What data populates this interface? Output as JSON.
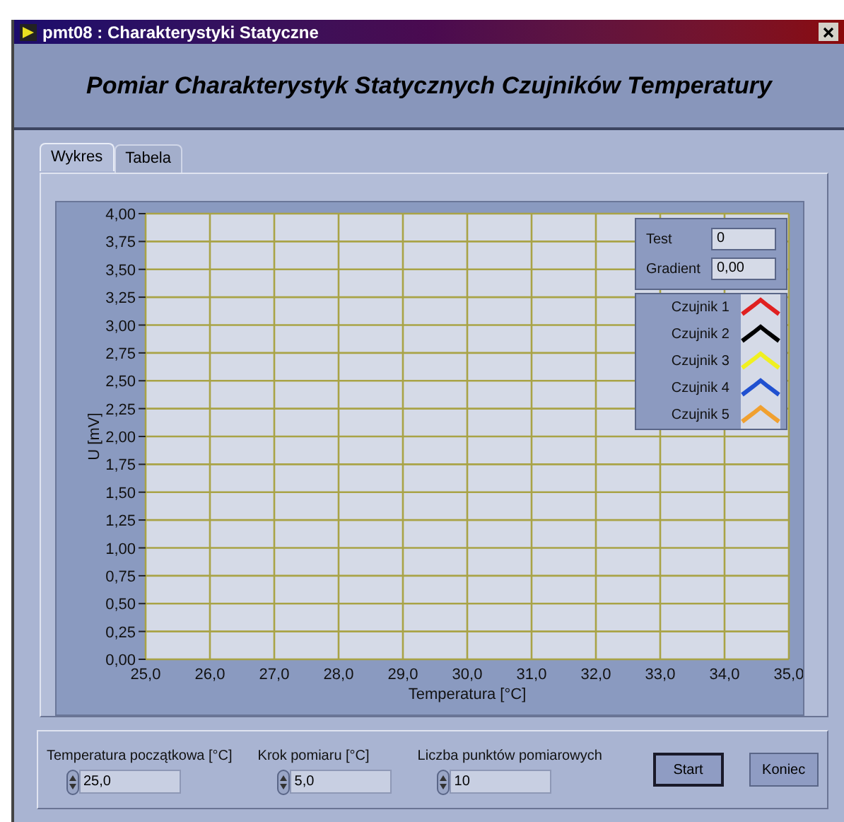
{
  "window": {
    "title": "pmt08 : Charakterystyki Statyczne"
  },
  "header": {
    "title": "Pomiar Charakterystyk Statycznych Czujników Temperatury"
  },
  "tabs": [
    {
      "label": "Wykres",
      "selected": true
    },
    {
      "label": "Tabela",
      "selected": false
    }
  ],
  "indicators": [
    {
      "label": "Test",
      "value": "0"
    },
    {
      "label": "Gradient",
      "value": "0,00"
    }
  ],
  "legend": [
    {
      "name": "Czujnik 1",
      "color": "#e02020"
    },
    {
      "name": "Czujnik 2",
      "color": "#000000"
    },
    {
      "name": "Czujnik 3",
      "color": "#f0f020"
    },
    {
      "name": "Czujnik 4",
      "color": "#2050d0"
    },
    {
      "name": "Czujnik 5",
      "color": "#f0a030"
    }
  ],
  "chart_data": {
    "type": "line",
    "xlabel": "Temperatura [°C]",
    "ylabel": "U [mV]",
    "grid": true,
    "xlim": [
      25,
      35
    ],
    "ylim": [
      0,
      4
    ],
    "xticks": [
      {
        "value": 25,
        "label": "25,0"
      },
      {
        "value": 26,
        "label": "26,0"
      },
      {
        "value": 27,
        "label": "27,0"
      },
      {
        "value": 28,
        "label": "28,0"
      },
      {
        "value": 29,
        "label": "29,0"
      },
      {
        "value": 30,
        "label": "30,0"
      },
      {
        "value": 31,
        "label": "31,0"
      },
      {
        "value": 32,
        "label": "32,0"
      },
      {
        "value": 33,
        "label": "33,0"
      },
      {
        "value": 34,
        "label": "34,0"
      },
      {
        "value": 35,
        "label": "35,0"
      }
    ],
    "yticks": [
      {
        "value": 0,
        "label": "0,00"
      },
      {
        "value": 0.25,
        "label": "0,25"
      },
      {
        "value": 0.5,
        "label": "0,50"
      },
      {
        "value": 0.75,
        "label": "0,75"
      },
      {
        "value": 1,
        "label": "1,00"
      },
      {
        "value": 1.25,
        "label": "1,25"
      },
      {
        "value": 1.5,
        "label": "1,50"
      },
      {
        "value": 1.75,
        "label": "1,75"
      },
      {
        "value": 2,
        "label": "2,00"
      },
      {
        "value": 2.25,
        "label": "2,25"
      },
      {
        "value": 2.5,
        "label": "2,50"
      },
      {
        "value": 2.75,
        "label": "2,75"
      },
      {
        "value": 3,
        "label": "3,00"
      },
      {
        "value": 3.25,
        "label": "3,25"
      },
      {
        "value": 3.5,
        "label": "3,50"
      },
      {
        "value": 3.75,
        "label": "3,75"
      },
      {
        "value": 4,
        "label": "4,00"
      }
    ]
  },
  "controls": [
    {
      "label": "Temperatura początkowa [°C]",
      "value": "25,0"
    },
    {
      "label": "Krok pomiaru [°C]",
      "value": "5,0"
    },
    {
      "label": "Liczba punktów pomiarowych",
      "value": "10"
    }
  ],
  "buttons": [
    {
      "label": "Start",
      "default": true
    },
    {
      "label": "Koniec",
      "default": false
    }
  ]
}
